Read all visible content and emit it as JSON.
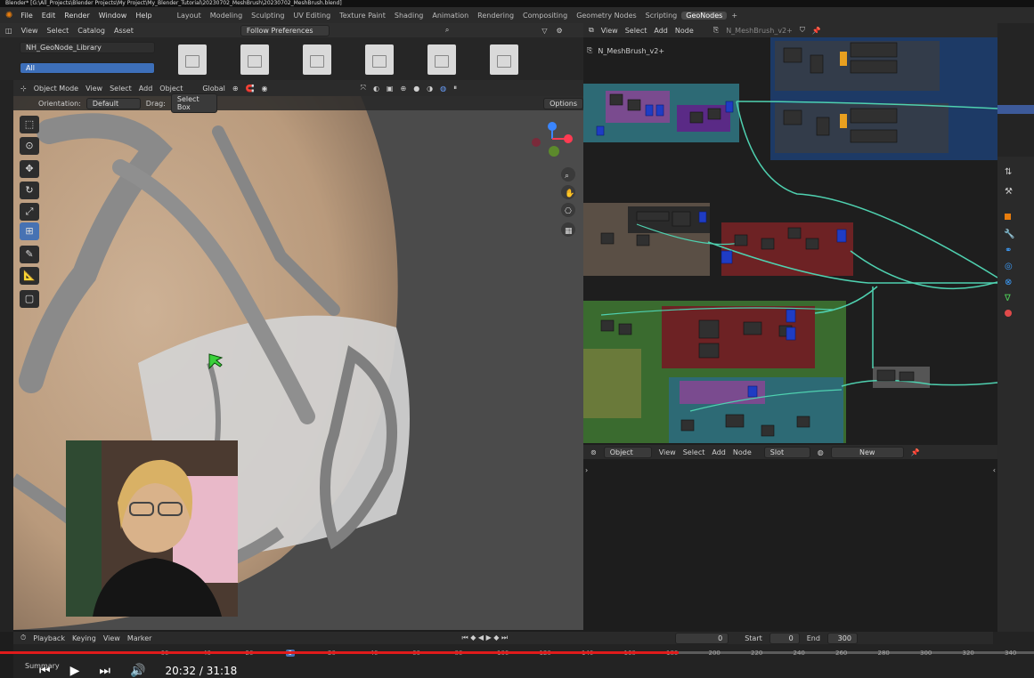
{
  "title_bar": "Blender* [G:\\All_Projects\\Blender Projects\\My Project\\My_Blender_Tutorial\\20230702_MeshBrush\\20230702_MeshBrush.blend]",
  "menu": [
    "File",
    "Edit",
    "Render",
    "Window",
    "Help"
  ],
  "workspaces": [
    "Layout",
    "Modeling",
    "Sculpting",
    "UV Editing",
    "Texture Paint",
    "Shading",
    "Animation",
    "Rendering",
    "Compositing",
    "Geometry Nodes",
    "Scripting",
    "GeoNodes"
  ],
  "active_workspace": "GeoNodes",
  "asset_browser": {
    "menu": [
      "View",
      "Select",
      "Catalog",
      "Asset"
    ],
    "library": "NH_GeoNode_Library",
    "filter": "Follow Preferences",
    "catalog_all": "All"
  },
  "viewport": {
    "mode": "Object Mode",
    "menu": [
      "View",
      "Select",
      "Add",
      "Object"
    ],
    "orientation_label": "Orientation:",
    "orientation_value": "Default",
    "drag_label": "Drag:",
    "drag_value": "Select Box",
    "transform": "Global",
    "options": "Options"
  },
  "node_editor": {
    "menu": [
      "View",
      "Select",
      "Add",
      "Node"
    ],
    "tree_name": "N_MeshBrush_v2+",
    "breadcrumb": "N_MeshBrush_v2+"
  },
  "lower_node_editor": {
    "type": "Object",
    "menu": [
      "View",
      "Select",
      "Add",
      "Node"
    ],
    "slot": "Slot",
    "new": "New"
  },
  "timeline": {
    "menu": [
      "Playback",
      "Keying",
      "View",
      "Marker"
    ],
    "current_frame": "0",
    "start_label": "Start",
    "start": "0",
    "end_label": "End",
    "end": "300",
    "ticks": [
      "-60",
      "-40",
      "-20",
      "0",
      "20",
      "40",
      "60",
      "80",
      "100",
      "120",
      "140",
      "160",
      "180",
      "200",
      "220",
      "240",
      "260",
      "280",
      "300",
      "320",
      "340"
    ],
    "summary": "Summary"
  },
  "video": {
    "time": "20:32 / 31:18",
    "progress": 0.656
  },
  "colors": {
    "accent": "#4772b3",
    "progress": "#e01b1b",
    "link": "#4fd1b0"
  }
}
